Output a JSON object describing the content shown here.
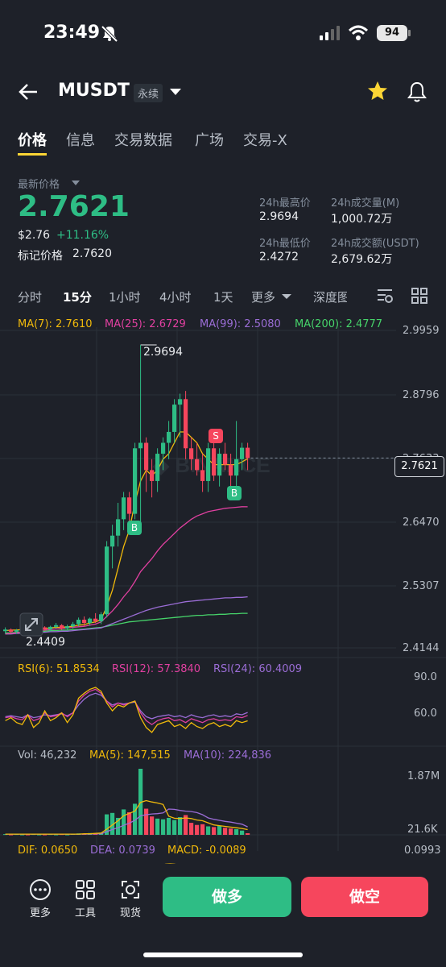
{
  "status": {
    "time": "23:49",
    "battery": "94"
  },
  "header": {
    "symbol": "MUSDT",
    "contract_tag": "永续"
  },
  "tabs": [
    "价格",
    "信息",
    "交易数据",
    "广场",
    "交易-X"
  ],
  "price": {
    "label": "最新价格",
    "last": "2.7621",
    "usd": "$2.76",
    "change": "+11.16%",
    "mark_label": "标记价格",
    "mark_value": "2.7620"
  },
  "stats": {
    "high_label": "24h最高价",
    "high": "2.9694",
    "vol_m_label": "24h成交量(M)",
    "vol_m": "1,000.72万",
    "low_label": "24h最低价",
    "low": "2.4272",
    "vol_usdt_label": "24h成交额(USDT)",
    "vol_usdt": "2,679.62万"
  },
  "intervals": [
    "分时",
    "15分",
    "1小时",
    "4小时",
    "1天",
    "更多",
    "深度图"
  ],
  "ma_legend": {
    "ma7": "MA(7): 2.7610",
    "ma25": "MA(25): 2.6729",
    "ma99": "MA(99): 2.5080",
    "ma200": "MA(200): 2.4777"
  },
  "price_axis": [
    "2.9959",
    "2.8796",
    "2.7633",
    "2.6470",
    "2.5307",
    "2.4144"
  ],
  "current_price_tag": "2.7621",
  "annotations": {
    "high": "2.9694",
    "low": "2.4409",
    "sell": "S",
    "buy": "B"
  },
  "rsi_legend": {
    "rsi6": "RSI(6): 51.8534",
    "rsi12": "RSI(12): 57.3840",
    "rsi24": "RSI(24): 60.4009"
  },
  "rsi_axis": [
    "90.0",
    "60.0"
  ],
  "vol_legend": {
    "vol": "Vol: 46,232",
    "ma5": "MA(5): 147,515",
    "ma10": "MA(10): 224,836"
  },
  "vol_axis": [
    "1.87M",
    "21.6K"
  ],
  "macd_legend": {
    "dif": "DIF: 0.0650",
    "dea": "DEA: 0.0739",
    "macd": "MACD: -0.0089"
  },
  "macd_axis": [
    "0.0993"
  ],
  "bottom": {
    "more": "更多",
    "tools": "工具",
    "spot": "现货",
    "long": "做多",
    "short": "做空"
  },
  "colors": {
    "up": "#2ebd85",
    "down": "#f6465d",
    "accent": "#fcd535",
    "ma7": "#f0b90b",
    "ma25": "#e040a0",
    "ma99": "#9b6dd6",
    "ma200": "#46d36a"
  },
  "chart_data": {
    "type": "candlestick",
    "candles": [
      [
        2.445,
        2.452,
        2.44,
        2.448
      ],
      [
        2.448,
        2.45,
        2.441,
        2.444
      ],
      [
        2.444,
        2.449,
        2.44,
        2.447
      ],
      [
        2.447,
        2.455,
        2.443,
        2.451
      ],
      [
        2.451,
        2.453,
        2.444,
        2.446
      ],
      [
        2.446,
        2.452,
        2.441,
        2.449
      ],
      [
        2.449,
        2.456,
        2.445,
        2.452
      ],
      [
        2.452,
        2.454,
        2.446,
        2.448
      ],
      [
        2.448,
        2.455,
        2.445,
        2.453
      ],
      [
        2.453,
        2.46,
        2.449,
        2.456
      ],
      [
        2.456,
        2.458,
        2.447,
        2.45
      ],
      [
        2.45,
        2.457,
        2.446,
        2.454
      ],
      [
        2.454,
        2.462,
        2.45,
        2.458
      ],
      [
        2.458,
        2.47,
        2.454,
        2.466
      ],
      [
        2.466,
        2.472,
        2.455,
        2.46
      ],
      [
        2.46,
        2.47,
        2.455,
        2.468
      ],
      [
        2.468,
        2.478,
        2.46,
        2.463
      ],
      [
        2.463,
        2.48,
        2.458,
        2.476
      ],
      [
        2.476,
        2.61,
        2.47,
        2.6
      ],
      [
        2.6,
        2.64,
        2.56,
        2.62
      ],
      [
        2.62,
        2.68,
        2.6,
        2.65
      ],
      [
        2.65,
        2.7,
        2.63,
        2.69
      ],
      [
        2.69,
        2.7,
        2.64,
        2.66
      ],
      [
        2.66,
        2.79,
        2.65,
        2.78
      ],
      [
        2.78,
        2.9694,
        2.64,
        2.79
      ],
      [
        2.79,
        2.8,
        2.7,
        2.74
      ],
      [
        2.74,
        2.76,
        2.69,
        2.72
      ],
      [
        2.72,
        2.78,
        2.7,
        2.77
      ],
      [
        2.77,
        2.8,
        2.74,
        2.79
      ],
      [
        2.79,
        2.83,
        2.76,
        2.81
      ],
      [
        2.81,
        2.87,
        2.79,
        2.86
      ],
      [
        2.86,
        2.88,
        2.8,
        2.87
      ],
      [
        2.87,
        2.885,
        2.76,
        2.78
      ],
      [
        2.78,
        2.8,
        2.74,
        2.76
      ],
      [
        2.76,
        2.79,
        2.73,
        2.74
      ],
      [
        2.74,
        2.77,
        2.7,
        2.72
      ],
      [
        2.72,
        2.79,
        2.7,
        2.78
      ],
      [
        2.78,
        2.8,
        2.72,
        2.73
      ],
      [
        2.73,
        2.78,
        2.71,
        2.77
      ],
      [
        2.77,
        2.79,
        2.74,
        2.75
      ],
      [
        2.75,
        2.77,
        2.71,
        2.73
      ],
      [
        2.73,
        2.83,
        2.7,
        2.76
      ],
      [
        2.76,
        2.79,
        2.74,
        2.781
      ],
      [
        2.781,
        2.79,
        2.74,
        2.7621
      ]
    ],
    "ylim": [
      2.4144,
      2.9959
    ],
    "ma7": [
      2.446,
      2.447,
      2.447,
      2.448,
      2.449,
      2.449,
      2.45,
      2.45,
      2.451,
      2.452,
      2.452,
      2.453,
      2.454,
      2.456,
      2.457,
      2.46,
      2.462,
      2.466,
      2.49,
      2.52,
      2.56,
      2.6,
      2.63,
      2.68,
      2.72,
      2.74,
      2.73,
      2.74,
      2.76,
      2.77,
      2.79,
      2.81,
      2.81,
      2.8,
      2.79,
      2.77,
      2.76,
      2.75,
      2.75,
      2.75,
      2.75,
      2.75,
      2.755,
      2.761
    ],
    "ma25": [
      2.44,
      2.441,
      2.442,
      2.443,
      2.444,
      2.445,
      2.446,
      2.447,
      2.448,
      2.449,
      2.45,
      2.451,
      2.452,
      2.453,
      2.454,
      2.456,
      2.458,
      2.462,
      2.472,
      2.482,
      2.494,
      2.508,
      2.52,
      2.536,
      2.554,
      2.566,
      2.578,
      2.592,
      2.604,
      2.614,
      2.624,
      2.634,
      2.642,
      2.65,
      2.656,
      2.66,
      2.664,
      2.666,
      2.668,
      2.67,
      2.671,
      2.672,
      2.673,
      2.6729
    ],
    "ma99": [
      2.44,
      2.44,
      2.441,
      2.441,
      2.442,
      2.442,
      2.443,
      2.443,
      2.444,
      2.444,
      2.445,
      2.445,
      2.446,
      2.447,
      2.448,
      2.449,
      2.45,
      2.451,
      2.455,
      2.459,
      2.463,
      2.467,
      2.471,
      2.475,
      2.479,
      2.483,
      2.486,
      2.489,
      2.491,
      2.493,
      2.495,
      2.497,
      2.499,
      2.5,
      2.501,
      2.502,
      2.503,
      2.504,
      2.505,
      2.506,
      2.506,
      2.507,
      2.507,
      2.508
    ],
    "ma200": [
      2.442,
      2.442,
      2.443,
      2.443,
      2.444,
      2.444,
      2.445,
      2.445,
      2.446,
      2.446,
      2.447,
      2.447,
      2.448,
      2.448,
      2.449,
      2.45,
      2.451,
      2.452,
      2.454,
      2.456,
      2.458,
      2.46,
      2.462,
      2.463,
      2.464,
      2.465,
      2.466,
      2.467,
      2.468,
      2.469,
      2.47,
      2.471,
      2.472,
      2.473,
      2.474,
      2.474,
      2.475,
      2.475,
      2.476,
      2.476,
      2.477,
      2.477,
      2.4777,
      2.4777
    ],
    "rsi6": [
      52,
      55,
      50,
      48,
      58,
      45,
      50,
      62,
      52,
      55,
      60,
      50,
      58,
      75,
      80,
      84,
      86,
      82,
      70,
      62,
      68,
      66,
      70,
      72,
      55,
      45,
      40,
      48,
      50,
      52,
      46,
      48,
      44,
      50,
      46,
      44,
      48,
      50,
      46,
      48,
      46,
      52,
      50,
      51.85
    ],
    "rsi12": [
      55,
      56,
      54,
      53,
      58,
      52,
      54,
      60,
      56,
      57,
      60,
      56,
      60,
      72,
      78,
      82,
      84,
      80,
      72,
      66,
      70,
      68,
      70,
      72,
      60,
      52,
      48,
      52,
      54,
      55,
      52,
      53,
      50,
      54,
      52,
      50,
      53,
      54,
      52,
      53,
      52,
      56,
      55,
      57.38
    ],
    "rsi24": [
      56,
      57,
      56,
      55,
      58,
      55,
      56,
      58,
      57,
      58,
      59,
      57,
      60,
      68,
      74,
      78,
      80,
      78,
      72,
      68,
      70,
      69,
      70,
      71,
      62,
      56,
      54,
      56,
      57,
      58,
      56,
      57,
      55,
      58,
      56,
      55,
      57,
      58,
      56,
      57,
      56,
      59,
      58,
      60.4
    ],
    "rsi_ylim": [
      30,
      100
    ],
    "volume": [
      0.02,
      0.01,
      0.02,
      0.01,
      0.01,
      0.02,
      0.01,
      0.01,
      0.02,
      0.01,
      0.02,
      0.01,
      0.03,
      0.04,
      0.03,
      0.05,
      0.04,
      0.06,
      0.58,
      0.62,
      0.48,
      0.72,
      0.64,
      0.88,
      1.87,
      0.74,
      0.52,
      0.46,
      0.44,
      0.48,
      0.42,
      0.5,
      0.56,
      0.34,
      0.28,
      0.3,
      0.24,
      0.22,
      0.26,
      0.2,
      0.18,
      0.16,
      0.12,
      0.046
    ],
    "vol_ma5": [
      0.02,
      0.02,
      0.02,
      0.02,
      0.02,
      0.02,
      0.02,
      0.02,
      0.02,
      0.02,
      0.02,
      0.02,
      0.02,
      0.02,
      0.03,
      0.03,
      0.04,
      0.05,
      0.16,
      0.28,
      0.4,
      0.54,
      0.61,
      0.67,
      0.92,
      0.97,
      0.93,
      0.9,
      0.86,
      0.53,
      0.47,
      0.46,
      0.48,
      0.46,
      0.42,
      0.4,
      0.34,
      0.28,
      0.26,
      0.24,
      0.22,
      0.2,
      0.18,
      0.1475
    ],
    "vol_ma10": [
      0.02,
      0.02,
      0.02,
      0.02,
      0.02,
      0.02,
      0.02,
      0.02,
      0.02,
      0.02,
      0.02,
      0.02,
      0.02,
      0.02,
      0.02,
      0.02,
      0.03,
      0.03,
      0.09,
      0.15,
      0.2,
      0.27,
      0.33,
      0.41,
      0.54,
      0.57,
      0.59,
      0.6,
      0.62,
      0.73,
      0.72,
      0.69,
      0.67,
      0.66,
      0.63,
      0.57,
      0.48,
      0.44,
      0.41,
      0.38,
      0.36,
      0.33,
      0.3,
      0.2248
    ],
    "vol_ylim": [
      0,
      1.87
    ]
  }
}
